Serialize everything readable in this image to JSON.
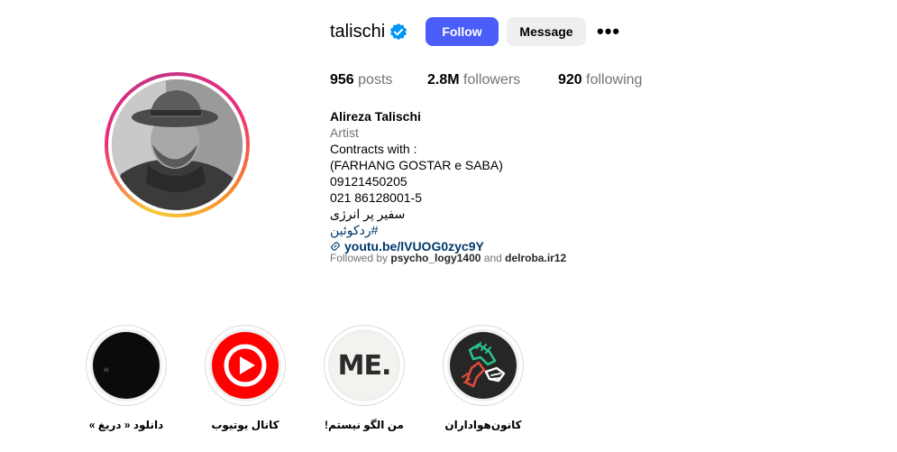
{
  "profile": {
    "username": "talischi",
    "follow_label": "Follow",
    "message_label": "Message",
    "more_label": "•••"
  },
  "stats": {
    "posts_count": "956",
    "posts_label": "posts",
    "followers_count": "2.8M",
    "followers_label": "followers",
    "following_count": "920",
    "following_label": "following"
  },
  "bio": {
    "name": "Alireza Talischi",
    "category": "Artist",
    "lines": [
      "Contracts with :",
      "(FARHANG GOSTAR e SABA)",
      "09121450205",
      "021 86128001-5"
    ],
    "hashtag_text": "سفیر پر انرژی ",
    "hashtag": "#ردکوئین",
    "link": "youtu.be/lVUOG0zyc9Y"
  },
  "followed_by": {
    "prefix": "Followed by ",
    "user1": "psycho_logy1400",
    "conjunction": " and ",
    "user2": "delroba.ir12"
  },
  "highlights": [
    {
      "label": "دانلود « دریغ »",
      "icon": "dark-video-thumb"
    },
    {
      "label": "کانال یوتیوب",
      "icon": "youtube-icon"
    },
    {
      "label": "من الگو نیستم!",
      "icon": "me-logo",
      "logo_text": "ME."
    },
    {
      "label": "کانون‌هواداران",
      "icon": "handshake-icon"
    }
  ],
  "colors": {
    "follow_button": "#4a5df9",
    "verified_badge": "#0095f6",
    "link": "#00376b",
    "youtube_red": "#ff0000"
  }
}
